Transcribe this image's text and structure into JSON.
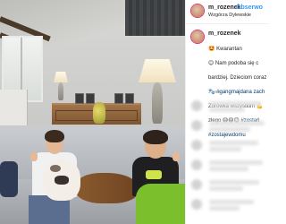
{
  "post": {
    "author": "m_rozenek",
    "follow_label": "Obserwo",
    "location": "Wzgórza Dylewskie",
    "caption_user": "m_rozenek",
    "caption_lines": [
      "Kwarantan",
      "Nam podoba się c",
      "bardziej. Dzieciom coraz",
      "#gangmajdana zach",
      "Zdrówka wszystkim",
      "złego",
      "#zostajewdomu"
    ],
    "caption_extra_tag": "#zostań",
    "time_ago": "1 tydz."
  },
  "photo": {
    "description_icon": "family-photo"
  },
  "colors": {
    "link": "#3897f0",
    "hashtag": "#003569",
    "text": "#262626",
    "muted": "#999999"
  }
}
